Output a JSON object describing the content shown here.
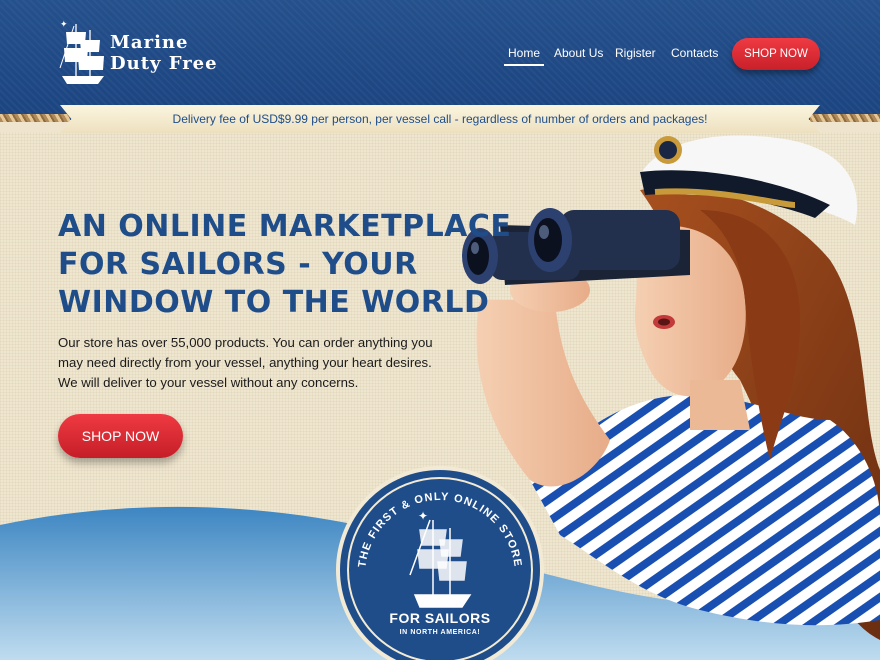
{
  "brand": {
    "line1": "Marine",
    "line2": "Duty Free"
  },
  "nav": {
    "items": [
      "Home",
      "About Us",
      "Rigister",
      "Contacts"
    ],
    "active": "Home"
  },
  "header": {
    "shop_label": "SHOP NOW"
  },
  "announcement": "Delivery fee of USD$9.99 per person, per vessel call - regardless of number of orders and packages!",
  "hero": {
    "headline": [
      "AN ONLINE MARKETPLACE",
      "FOR SAILORS - YOUR",
      "WINDOW TO THE WORLD"
    ],
    "description": [
      "Our store has over 55,000 products. You can order anything you",
      "may need directly from your vessel, anything your heart desires.",
      "We will deliver to your vessel without any concerns."
    ],
    "shop_label": "SHOP NOW"
  },
  "badge": {
    "arc_text": "THE FIRST & ONLY ONLINE STORE",
    "main": "FOR SAILORS",
    "sub": "IN NORTH AMERICA!"
  },
  "colors": {
    "navy": "#1f4d8a",
    "accent_red": "#e0313b",
    "cream": "#efe6cf",
    "sea": "#4a93c8"
  },
  "icons": [
    "sailing-ship-logo-icon",
    "sailing-ship-badge-icon"
  ]
}
